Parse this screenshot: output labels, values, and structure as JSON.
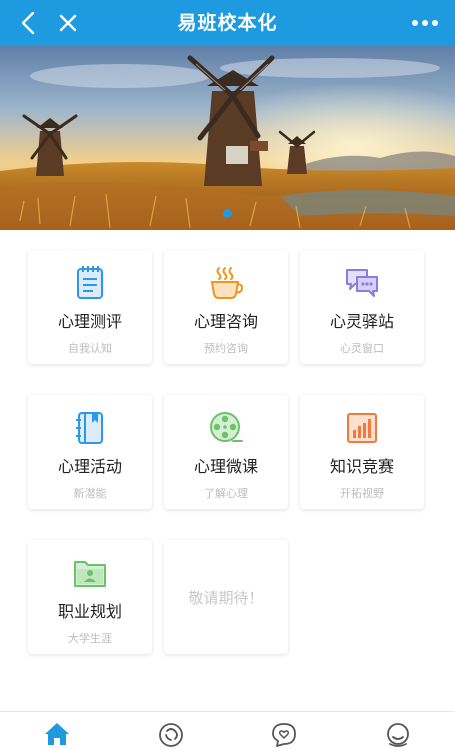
{
  "header": {
    "title": "易班校本化",
    "back_icon": "chevron-left-icon",
    "close_icon": "close-icon",
    "more_icon": "more-dots-icon",
    "color": "#1e9ae0"
  },
  "banner": {
    "active_index": 0,
    "slide_count": 1
  },
  "cards": [
    {
      "label": "心理测评",
      "sub": "自我认知",
      "icon": "notebook-icon",
      "color": "#2a9ae8"
    },
    {
      "label": "心理咨询",
      "sub": "预约咨询",
      "icon": "coffee-cup-icon",
      "color": "#f0951d"
    },
    {
      "label": "心灵驿站",
      "sub": "心灵窗口",
      "icon": "chat-bubbles-icon",
      "color": "#8a7de0"
    },
    {
      "label": "心理活动",
      "sub": "新潜能",
      "icon": "book-icon",
      "color": "#2a9ae8"
    },
    {
      "label": "心理微课",
      "sub": "了解心理",
      "icon": "film-reel-icon",
      "color": "#6cc16a"
    },
    {
      "label": "知识竞赛",
      "sub": "开拓视野",
      "icon": "bar-chart-icon",
      "color": "#f07a3c"
    },
    {
      "label": "职业规划",
      "sub": "大学生涯",
      "icon": "folder-person-icon",
      "color": "#6cc16a"
    }
  ],
  "placeholder": "敬请期待！",
  "tabbar": [
    {
      "icon": "home-icon",
      "active": true
    },
    {
      "icon": "discover-icon",
      "active": false
    },
    {
      "icon": "heart-chat-icon",
      "active": false
    },
    {
      "icon": "profile-icon",
      "active": false
    }
  ]
}
